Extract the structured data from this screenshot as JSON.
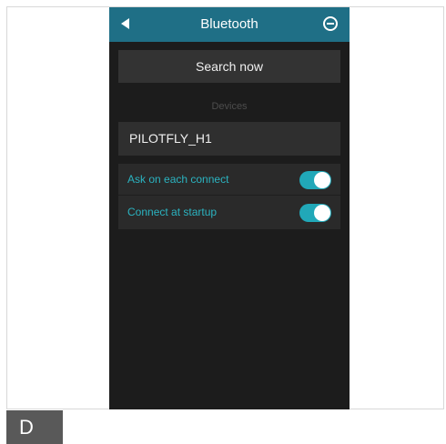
{
  "header": {
    "title": "Bluetooth",
    "back_icon": "back-arrow-icon",
    "menu_icon": "circle-minus-icon",
    "color": "#1f6f86"
  },
  "search": {
    "label": "Search now"
  },
  "devices": {
    "section_label": "Devices",
    "items": [
      {
        "name": "PILOTFLY_H1"
      }
    ]
  },
  "settings": {
    "items": [
      {
        "label": "Ask on each connect",
        "enabled": true
      },
      {
        "label": "Connect at startup",
        "enabled": true
      }
    ],
    "accent_color": "#2bb3c0"
  },
  "caption": {
    "label": "D"
  }
}
